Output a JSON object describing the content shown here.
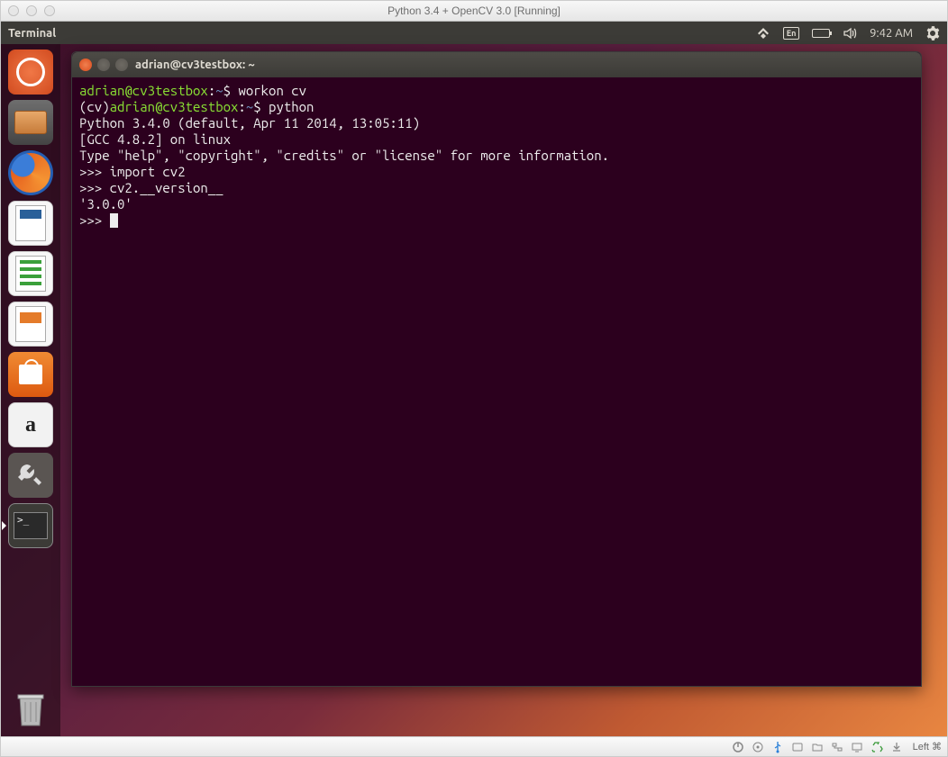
{
  "vm": {
    "title": "Python 3.4 + OpenCV 3.0 [Running]",
    "status_label": "Left ⌘",
    "status_icons": [
      "power",
      "optical-disk",
      "usb",
      "disk",
      "folder",
      "network",
      "display",
      "sound",
      "recycle",
      "download"
    ]
  },
  "ubuntu": {
    "panel": {
      "app_title": "Terminal",
      "indicators": {
        "network": "network-icon",
        "keyboard": "En",
        "battery": "battery-icon",
        "sound": "sound-icon",
        "time": "9:42 AM",
        "session": "gear-icon"
      }
    },
    "launcher": [
      {
        "name": "ubuntu-dash",
        "label": "Dash"
      },
      {
        "name": "files",
        "label": "Files"
      },
      {
        "name": "firefox",
        "label": "Firefox"
      },
      {
        "name": "libreoffice-writer",
        "label": "Writer"
      },
      {
        "name": "libreoffice-calc",
        "label": "Calc"
      },
      {
        "name": "libreoffice-impress",
        "label": "Impress"
      },
      {
        "name": "ubuntu-software",
        "label": "Software"
      },
      {
        "name": "amazon",
        "label": "Amazon"
      },
      {
        "name": "system-settings",
        "label": "Settings"
      },
      {
        "name": "terminal",
        "label": "Terminal"
      },
      {
        "name": "trash",
        "label": "Trash"
      }
    ]
  },
  "terminal": {
    "title": "adrian@cv3testbox: ~",
    "lines": {
      "l1_user": "adrian@cv3testbox",
      "l1_path": "~",
      "l1_cmd": "workon cv",
      "l2_prefix": "(cv)",
      "l2_user": "adrian@cv3testbox",
      "l2_path": "~",
      "l2_cmd": "python",
      "l3": "Python 3.4.0 (default, Apr 11 2014, 13:05:11)",
      "l4": "[GCC 4.8.2] on linux",
      "l5": "Type \"help\", \"copyright\", \"credits\" or \"license\" for more information.",
      "l6_prompt": ">>> ",
      "l6_cmd": "import cv2",
      "l7_prompt": ">>> ",
      "l7_cmd": "cv2.__version__",
      "l8": "'3.0.0'",
      "l9_prompt": ">>> "
    }
  }
}
